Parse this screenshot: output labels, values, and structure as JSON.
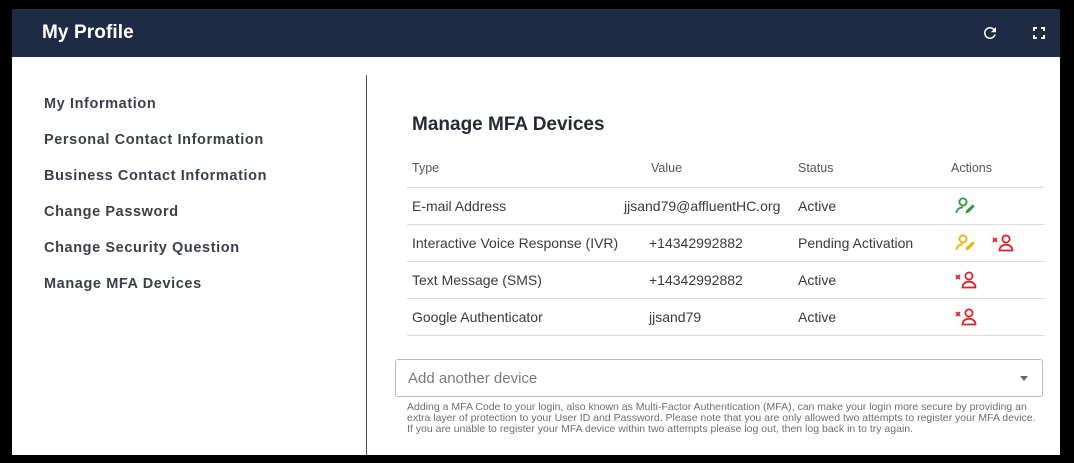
{
  "header": {
    "title": "My Profile",
    "refresh_icon": "refresh-icon",
    "fullscreen_icon": "fullscreen-icon",
    "background": "#1d2b45"
  },
  "sidebar": {
    "items": [
      {
        "label": "My Information"
      },
      {
        "label": "Personal Contact Information"
      },
      {
        "label": "Business Contact Information"
      },
      {
        "label": "Change Password"
      },
      {
        "label": "Change Security Question"
      },
      {
        "label": "Manage MFA Devices"
      }
    ]
  },
  "main": {
    "title": "Manage MFA Devices",
    "table": {
      "headers": {
        "type": "Type",
        "value": "Value",
        "status": "Status",
        "actions": "Actions"
      },
      "rows": [
        {
          "type": "E-mail Address",
          "value": "jjsand79@affluentHC.org",
          "status": "Active",
          "actions": [
            "edit-user-icon"
          ]
        },
        {
          "type": "Interactive Voice Response (IVR)",
          "value": "+14342992882",
          "status": "Pending Activation",
          "actions": [
            "edit-user-icon",
            "remove-user-icon"
          ]
        },
        {
          "type": "Text Message (SMS)",
          "value": "+14342992882",
          "status": "Active",
          "actions": [
            "remove-user-icon"
          ]
        },
        {
          "type": "Google Authenticator",
          "value": "jjsand79",
          "status": "Active",
          "actions": [
            "remove-user-icon"
          ]
        }
      ]
    },
    "add_device": {
      "placeholder": "Add another device",
      "icon": "chevron-down-icon"
    },
    "help_text": "Adding a MFA Code to your login, also known as Multi-Factor Authentication (MFA), can make your login more secure by providing an extra layer of protection to your User ID and Password. Please note that you are only allowed two attempts to register your MFA device. If you are unable to register your MFA device within two attempts please log out, then log back in to try again."
  },
  "colors": {
    "active_edit": "#2e9a3a",
    "pending_edit": "#e8b400",
    "remove": "#d9262b"
  }
}
